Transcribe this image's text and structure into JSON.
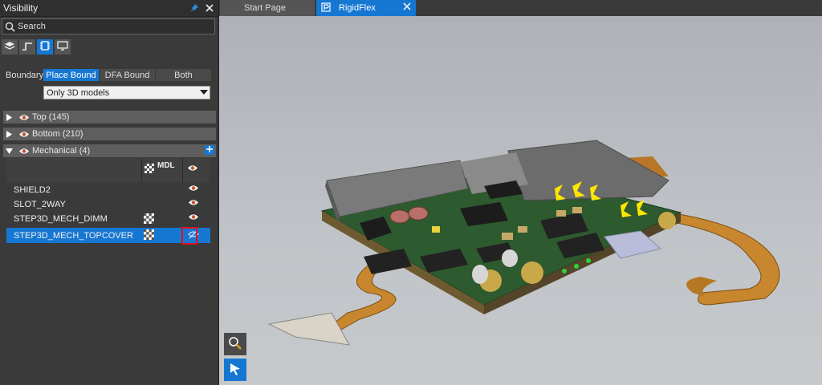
{
  "panel": {
    "title": "Visibility",
    "search_placeholder": "Search",
    "toolbar": [
      "layers-icon",
      "route-icon",
      "component-icon",
      "monitor-icon"
    ],
    "boundary_label": "Boundary",
    "boundary_options": [
      "Place Bound",
      "DFA Bound",
      "Both"
    ],
    "boundary_selected": "Place Bound",
    "filter_value": "Only 3D models",
    "groups": [
      {
        "name": "Top (145)",
        "expanded": false
      },
      {
        "name": "Bottom (210)",
        "expanded": false
      },
      {
        "name": "Mechanical (4)",
        "expanded": true
      }
    ],
    "columns": {
      "mdl": "MDL"
    },
    "rows": [
      {
        "name": "SHIELD2",
        "mdl": false,
        "visible": true
      },
      {
        "name": "SLOT_2WAY",
        "mdl": false,
        "visible": true
      },
      {
        "name": "STEP3D_MECH_DIMM",
        "mdl": true,
        "visible": true
      },
      {
        "name": "STEP3D_MECH_TOPCOVER",
        "mdl": true,
        "visible": false,
        "selected": true
      }
    ]
  },
  "tabs": [
    {
      "label": "Start Page",
      "active": false
    },
    {
      "label": "RigidFlex",
      "active": true
    }
  ],
  "colors": {
    "accent": "#1677d2",
    "highlight": "#e0101a",
    "panel": "#3a3a3a"
  }
}
